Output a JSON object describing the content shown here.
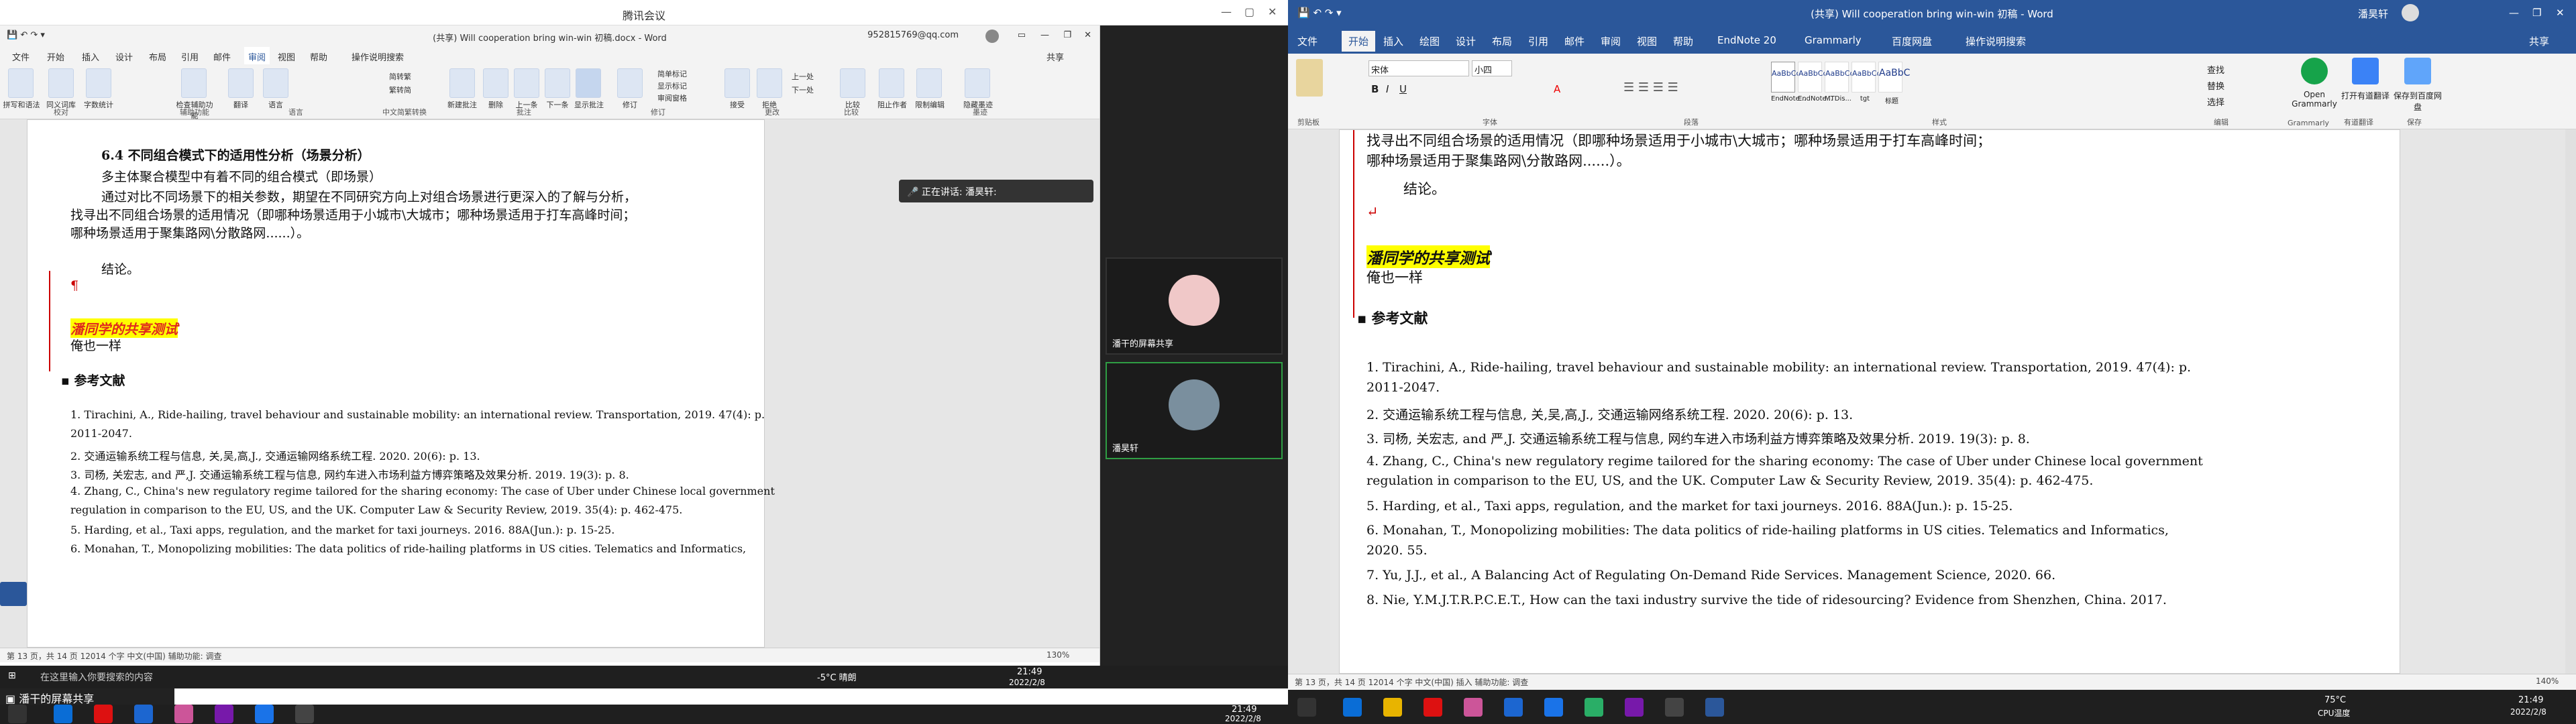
{
  "meeting": {
    "title": "腾讯会议",
    "sharing_label": "潘干的屏幕共享",
    "speaking": "正在讲话: 潘昊轩:",
    "participants": [
      {
        "name": "潘干的屏幕共享"
      },
      {
        "name": "潘昊轩"
      }
    ]
  },
  "shared_word": {
    "title": "(共享) Will cooperation bring win-win 初稿.docx - Word",
    "account": "952815769@qq.com",
    "tabs": [
      "文件",
      "开始",
      "插入",
      "设计",
      "布局",
      "引用",
      "邮件",
      "审阅",
      "视图",
      "帮助",
      "操作说明搜索"
    ],
    "active_tab": "审阅",
    "share": "共享",
    "ribbon_groups": [
      "校对",
      "辅助功能",
      "语言",
      "中文简繁转换",
      "批注",
      "修订",
      "更改",
      "比较",
      "墨迹"
    ],
    "ribbon_buttons": [
      "拼写和语法",
      "同义词库",
      "字数统计",
      "检查辅助功能",
      "翻译",
      "语言",
      "简转繁",
      "繁转简",
      "新建批注",
      "删除",
      "上一条",
      "下一条",
      "显示批注",
      "修订",
      "简单标记",
      "显示标记",
      "审阅窗格",
      "接受",
      "拒绝",
      "上一处",
      "下一处",
      "比较",
      "阻止作者",
      "限制编辑",
      "隐藏墨迹"
    ],
    "heading": "6.4 不同组合模式下的适用性分析（场景分析）",
    "lines": [
      "多主体聚合模型中有着不同的组合模式（即场景）",
      "通过对比不同场景下的相关参数，期望在不同研究方向上对组合场景进行更深入的了解与分析，",
      "找寻出不同组合场景的适用情况（即哪种场景适用于小城市\\大城市；哪种场景适用于打车高峰时间；",
      "哪种场景适用于聚集路网\\分散路网......）。",
      "结论。",
      "潘同学的共享测试",
      "俺也一样",
      "参考文献"
    ],
    "refs": [
      "1.    Tirachini, A., Ride-hailing, travel behaviour and sustainable mobility: an international review. Transportation, 2019. 47(4): p.",
      "2011-2047.",
      "2.    交通运输系统工程与信息, 关,吴,高,J., 交通运输网络系统工程. 2020. 20(6): p. 13.",
      "3.    司杨, 关宏志, and 严,J. 交通运输系统工程与信息, 网约车进入市场利益方博弈策略及效果分析. 2019. 19(3): p. 8.",
      "4.    Zhang, C., China's new regulatory regime tailored for the sharing economy: The case of Uber under Chinese local government",
      "regulation in comparison to the EU, US, and the UK. Computer Law & Security Review, 2019. 35(4): p. 462-475.",
      "5.    Harding, et al., Taxi apps, regulation, and the market for taxi journeys. 2016. 88A(Jun.): p. 15-25.",
      "6.    Monahan, T., Monopolizing mobilities: The data politics of ride-hailing platforms in US cities. Telematics and Informatics,"
    ],
    "status": "第 13 页，共 14 页    12014 个字    中文(中国)    辅助功能: 调查",
    "zoom": "130%"
  },
  "my_word": {
    "title": "(共享) Will cooperation bring win-win 初稿 - Word",
    "user": "潘昊轩",
    "tabs": [
      "文件",
      "开始",
      "插入",
      "绘图",
      "设计",
      "布局",
      "引用",
      "邮件",
      "审阅",
      "视图",
      "帮助",
      "EndNote 20",
      "Grammarly",
      "百度网盘",
      "操作说明搜索"
    ],
    "active_tab": "开始",
    "share": "共享",
    "font_name": "宋体",
    "font_size": "小四",
    "styles": [
      "AaBbCcDd",
      "AaBbCcDd",
      "AaBbCcDd",
      "AaBbCcE",
      "AaBbC"
    ],
    "style_names": [
      "EndNote...",
      "EndNote...",
      "MTDis...",
      "tgt",
      "标题"
    ],
    "ribbon_groups": [
      "剪贴板",
      "字体",
      "段落",
      "样式",
      "编辑",
      "Grammarly",
      "有道翻译",
      "保存"
    ],
    "right_buttons": [
      "查找",
      "替换",
      "选择",
      "Open Grammarly",
      "打开有道翻译",
      "保存到百度网盘"
    ],
    "lines": [
      "找寻出不同组合场景的适用情况（即哪种场景适用于小城市\\大城市；哪种场景适用于打车高峰时间；",
      "哪种场景适用于聚集路网\\分散路网......）。",
      "结论。",
      "潘同学的共享测试",
      "俺也一样",
      "参考文献"
    ],
    "refs": [
      "1.    Tirachini, A., Ride-hailing, travel behaviour and sustainable mobility: an international review. Transportation, 2019. 47(4): p.",
      "2011-2047.",
      "2.    交通运输系统工程与信息, 关,吴,高,J., 交通运输网络系统工程. 2020. 20(6): p. 13.",
      "3.    司杨, 关宏志, and 严,J. 交通运输系统工程与信息, 网约车进入市场利益方博弈策略及效果分析. 2019. 19(3): p. 8.",
      "4.    Zhang, C., China's new regulatory regime tailored for the sharing economy: The case of Uber under Chinese local government",
      "regulation in comparison to the EU, US, and the UK. Computer Law & Security Review, 2019. 35(4): p. 462-475.",
      "5.    Harding, et al., Taxi apps, regulation, and the market for taxi journeys. 2016. 88A(Jun.): p. 15-25.",
      "6.    Monahan, T., Monopolizing mobilities: The data politics of ride-hailing platforms in US cities. Telematics and Informatics,",
      "2020. 55.",
      "7.    Yu, J.J., et al., A Balancing Act of Regulating On-Demand Ride Services. Management Science, 2020. 66.",
      "8.    Nie, Y.M.J.T.R.P.C.E.T., How can the taxi industry survive the tide of ridesourcing? Evidence from Shenzhen, China. 2017."
    ],
    "status": "第 13 页，共 14 页    12014 个字    中文(中国)    插入    辅助功能: 调查",
    "zoom": "140%"
  },
  "taskbar_left": {
    "search": "在这里输入你要搜索的内容",
    "weather": "-5°C 晴朗",
    "time": "21:49",
    "date": "2022/2/8"
  },
  "taskbar_right": {
    "temp": "75°C",
    "cpu": "CPU温度",
    "time": "21:49",
    "date": "2022/2/8"
  },
  "colors": {
    "word_blue": "#2b579a",
    "highlight": "#ffff00",
    "highlight_text": "#e0281e",
    "taskbar": "#1f1f1f"
  }
}
